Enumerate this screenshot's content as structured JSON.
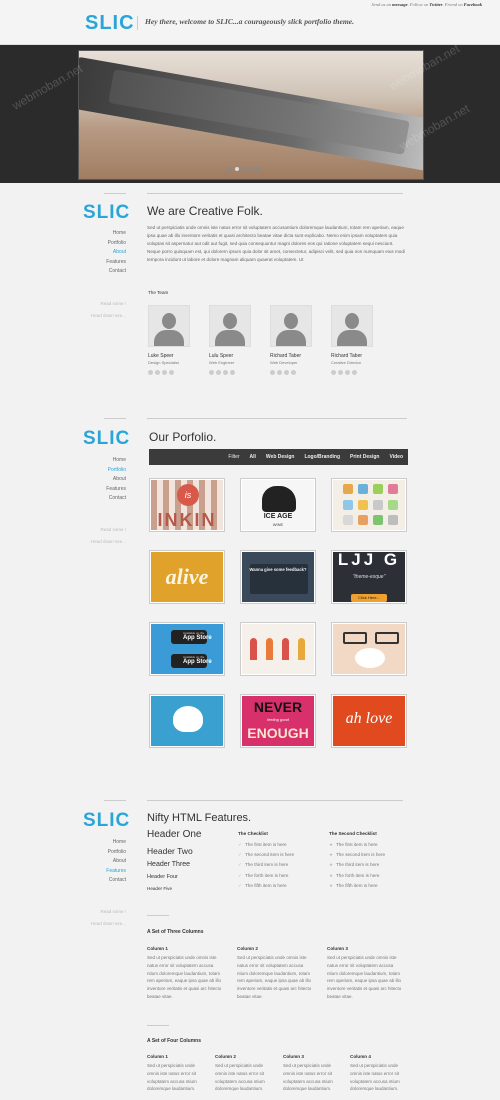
{
  "header": {
    "logo": "SLIC",
    "tagline": "Hey there, welcome to SLIC...a courageously slick portfolio theme.",
    "links_pre": "Send us an",
    "link_message": "message",
    "links_mid": ". Follow on",
    "link_twitter": "Twitter",
    "links_mid2": ". Friend on",
    "link_facebook": "Facebook"
  },
  "hero": {
    "slides": 5,
    "active_slide": 1,
    "watermark": "webmoban.net"
  },
  "about": {
    "logo": "SLIC",
    "title": "We are Creative Folk.",
    "nav": [
      "Home",
      "Portfolio",
      "About",
      "Features",
      "Contact"
    ],
    "active_nav": "About",
    "side_links": [
      "Read some !",
      "Head down see..."
    ],
    "paragraph": "Sed ut perspiciatis unde omnis iste natus error sit voluptatem accusantium doloremque laudantium, totam rem aperiam, eaque ipsa quae ab illo inventore veritatis et quasi architecto beatae vitae dicta sunt explicabo. Nemo enim ipsam voluptatem quia voluptas sit aspernatur aut odit aut fugit, sed quia consequuntur magni dolores eos qui ratione voluptatem sequi nesciunt. Neque porro quisquam est, qui dolorem ipsum quia dolor sit amet, consectetur, adipisci velit, sed quia non numquam eius modi tempora incidunt ut labore et dolore magnam aliquam quaerat voluptatem. Ut",
    "team_heading": "The Team",
    "team": [
      {
        "name": "Luke Speer",
        "role": "Design Specialist"
      },
      {
        "name": "Lulu Speer",
        "role": "Web Engineer"
      },
      {
        "name": "Richard Taber",
        "role": "Web Developer"
      },
      {
        "name": "Richard Taber",
        "role": "Creative Director"
      }
    ]
  },
  "portfolio": {
    "logo": "SLIC",
    "title": "Our Porfolio.",
    "nav": [
      "Home",
      "Portfolio",
      "About",
      "Features",
      "Contact"
    ],
    "active_nav": "Portfolio",
    "side_links": [
      "Read some !",
      "Head down see..."
    ],
    "filters": [
      "Filter",
      "All",
      "Web Design",
      "Logo/Branding",
      "Print Design",
      "Video"
    ],
    "thumbs": [
      {
        "text": "INKIN",
        "badge": "is"
      },
      {
        "text": "ICE AGE",
        "sub": "WINE"
      },
      {
        "text": ""
      },
      {
        "text": "alive"
      },
      {
        "text": "Wanna give some feedback?"
      },
      {
        "text": "LJJ G",
        "sub": "\"theme-esque\"",
        "button": "Click Here..."
      },
      {
        "text": "App Store",
        "sub": "Available on the"
      },
      {
        "text": ""
      },
      {
        "text": ""
      },
      {
        "text": ""
      },
      {
        "text": "NEVER",
        "mid": "feeling good",
        "sub": "ENOUGH"
      },
      {
        "text": "ah love"
      }
    ]
  },
  "features": {
    "logo": "SLIC",
    "title": "Nifty HTML Features.",
    "nav": [
      "Home",
      "Portfolio",
      "About",
      "Features",
      "Contact"
    ],
    "active_nav": "Features",
    "side_links": [
      "Read some !",
      "Head down see..."
    ],
    "headers": [
      "Header One",
      "Header Two",
      "Header Three",
      "Header Four",
      "Header Five"
    ],
    "checklist_title": "The Checklist",
    "checklist": [
      "The first item is here",
      "The second item is here",
      "The third item is here",
      "The forth item is here",
      "The fifth item is here"
    ],
    "checklist2_title": "The Second Checklist",
    "checklist2": [
      "The first item is here",
      "The second item is here",
      "The third item is here",
      "The forth item is here",
      "The fifth item is here"
    ],
    "three_title": "A Set of Three Columns",
    "three_cols": [
      {
        "title": "Column 1",
        "text": "Sed ut perspiciatis unde omnis iste natus error sit voluptatem accusa ntium doloremque laudantium, totam rem aperiam, eaque ipsa quae ab illo inventore veritatis et quasi arc hitecto beatae vitae."
      },
      {
        "title": "Column 2",
        "text": "Sed ut perspiciatis unde omnis iste natus error sit voluptatem accusa ntium doloremque laudantium, totam rem aperiam, eaque ipsa quae ab illo inventore veritatis et quasi arc hitecto beatae vitae."
      },
      {
        "title": "Column 3",
        "text": "Sed ut perspiciatis unde omnis iste natus error sit voluptatem accusa ntium doloremque laudantium, totam rem aperiam, eaque ipsa quae ab illo inventore veritatis et quasi arc hitecto beatae vitae."
      }
    ],
    "four_title": "A Set of Four Columns",
    "four_cols": [
      {
        "title": "Column 1",
        "text": "Sed ut perspiciatis unde omnis iste natus error sit voluptatem accusa ntium doloremque laudantium."
      },
      {
        "title": "Column 2",
        "text": "Sed ut perspiciatis unde omnis iste natus error sit voluptatem accusa ntium doloremque laudantium."
      },
      {
        "title": "Column 3",
        "text": "Sed ut perspiciatis unde omnis iste natus error sit voluptatem accusa ntium doloremque laudantium."
      },
      {
        "title": "Column 4",
        "text": "Sed ut perspiciatis unde omnis iste natus error sit voluptatem accusa ntium doloremque laudantium."
      }
    ]
  },
  "colors": {
    "accent": "#2aa5d8",
    "dark": "#2b2b2b"
  }
}
